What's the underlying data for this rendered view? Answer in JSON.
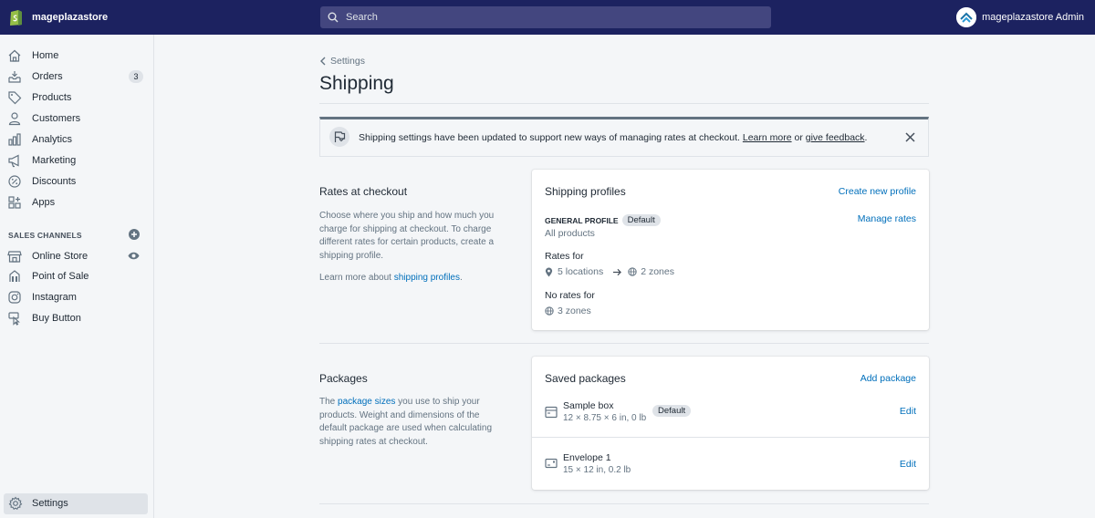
{
  "topbar": {
    "store_name": "mageplazastore",
    "search_placeholder": "Search",
    "account_name": "mageplazastore Admin"
  },
  "sidebar": {
    "items": [
      {
        "label": "Home",
        "icon": "home-icon"
      },
      {
        "label": "Orders",
        "icon": "orders-icon",
        "badge": "3"
      },
      {
        "label": "Products",
        "icon": "tag-icon"
      },
      {
        "label": "Customers",
        "icon": "person-icon"
      },
      {
        "label": "Analytics",
        "icon": "bar-chart-icon"
      },
      {
        "label": "Marketing",
        "icon": "megaphone-icon"
      },
      {
        "label": "Discounts",
        "icon": "discount-icon"
      },
      {
        "label": "Apps",
        "icon": "apps-icon"
      }
    ],
    "channels_title": "SALES CHANNELS",
    "channels": [
      {
        "label": "Online Store",
        "icon": "store-icon"
      },
      {
        "label": "Point of Sale",
        "icon": "pos-icon"
      },
      {
        "label": "Instagram",
        "icon": "instagram-icon"
      },
      {
        "label": "Buy Button",
        "icon": "buy-button-icon"
      }
    ],
    "settings_label": "Settings"
  },
  "main": {
    "breadcrumb": "Settings",
    "title": "Shipping",
    "banner": {
      "text": "Shipping settings have been updated to support new ways of managing rates at checkout. ",
      "learn_more": "Learn more",
      "or": " or ",
      "feedback": "give feedback",
      "end": "."
    },
    "rates_section": {
      "title": "Rates at checkout",
      "desc": "Choose where you ship and how much you charge for shipping at checkout. To charge different rates for certain products, create a shipping profile.",
      "learn_prefix": "Learn more about ",
      "learn_link": "shipping profiles",
      "learn_suffix": "."
    },
    "profiles_card": {
      "title": "Shipping profiles",
      "create_link": "Create new profile",
      "profile_name": "GENERAL PROFILE",
      "profile_badge": "Default",
      "profile_sub": "All products",
      "manage_link": "Manage rates",
      "rates_for_label": "Rates for",
      "locations": "5 locations",
      "zones": "2 zones",
      "no_rates_label": "No rates for",
      "no_rates_zones": "3 zones"
    },
    "packages_section": {
      "title": "Packages",
      "desc_prefix": "The ",
      "desc_link": "package sizes",
      "desc_suffix": " you use to ship your products. Weight and dimensions of the default package are used when calculating shipping rates at checkout."
    },
    "packages_card": {
      "title": "Saved packages",
      "add_link": "Add package",
      "packages": [
        {
          "name": "Sample box",
          "dims": "12 × 8.75 × 6 in, 0 lb",
          "badge": "Default",
          "edit": "Edit"
        },
        {
          "name": "Envelope 1",
          "dims": "15 × 12 in, 0.2 lb",
          "edit": "Edit"
        }
      ]
    }
  }
}
